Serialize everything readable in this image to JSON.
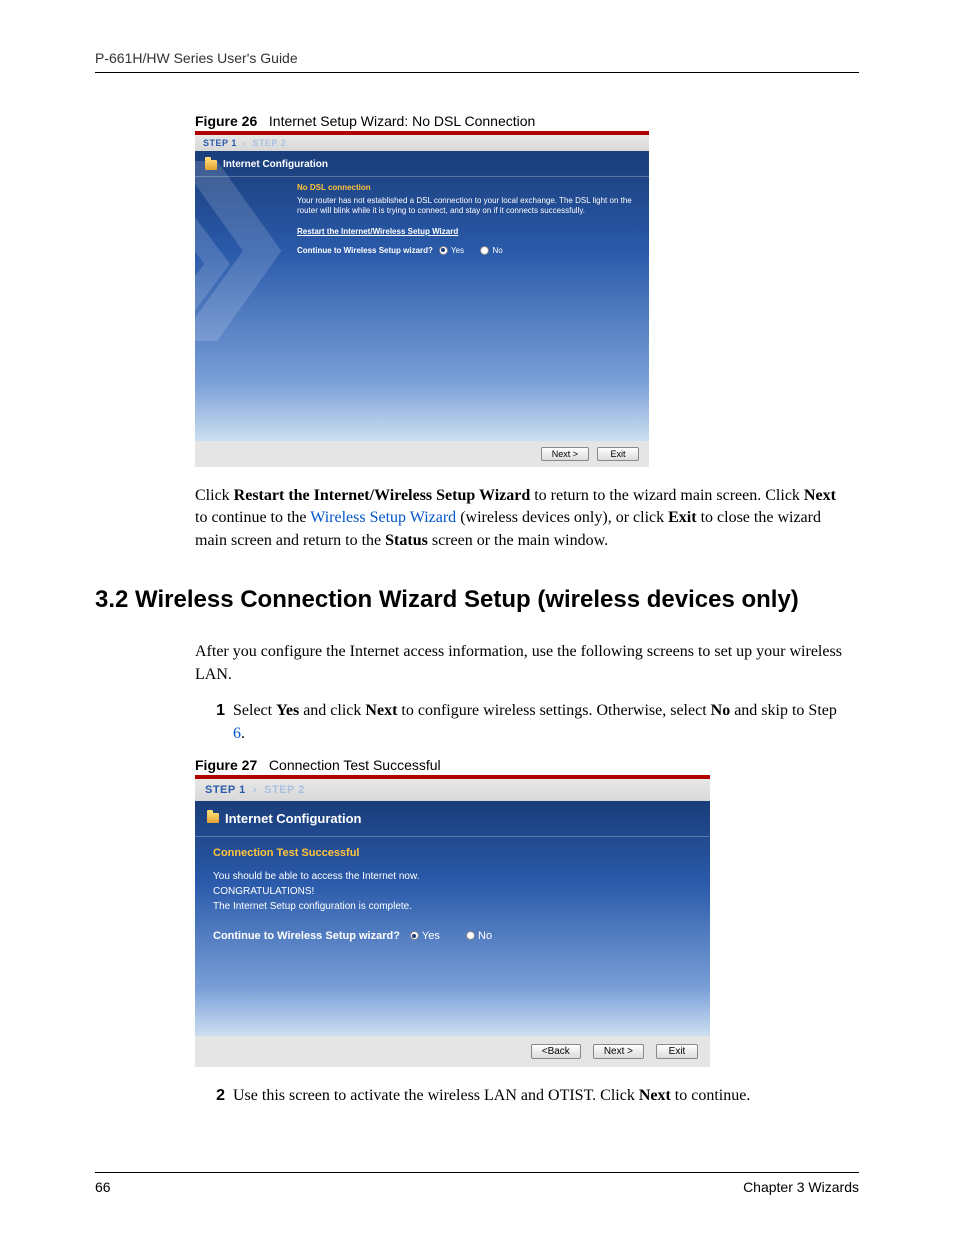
{
  "header": {
    "guide_title": "P-661H/HW Series User's Guide"
  },
  "fig26": {
    "label": "Figure 26",
    "title": "Internet Setup Wizard: No DSL Connection",
    "steps": {
      "s1": "STEP 1",
      "arrow": "›",
      "s2": "STEP 2"
    },
    "panel_title": "Internet Configuration",
    "status_title": "No DSL connection",
    "status_desc": "Your router has not established a DSL connection to your local exchange. The DSL light on the router will blink while it is trying to connect, and stay on if it connects successfully.",
    "restart_link": "Restart the Internet/Wireless Setup Wizard",
    "continue_label": "Continue to Wireless Setup wizard?",
    "yes": "Yes",
    "no": "No",
    "btn_next": "Next >",
    "btn_exit": "Exit"
  },
  "para1": {
    "pre": "Click ",
    "b1": "Restart the Internet/Wireless Setup Wizard",
    "mid1": " to return to the wizard main screen. Click ",
    "b2": "Next",
    "mid2": " to continue to the ",
    "link": "Wireless Setup Wizard",
    "mid3": " (wireless devices only), or click ",
    "b3": "Exit",
    "mid4": " to close the wizard main screen and return to the ",
    "b4": "Status",
    "end": " screen or the main window."
  },
  "section": {
    "heading": "3.2  Wireless Connection Wizard Setup (wireless devices only)"
  },
  "para2": "After you configure the Internet access information, use the following screens to set up your wireless LAN.",
  "step1": {
    "num": "1",
    "pre": "Select ",
    "b1": "Yes",
    "mid1": " and click ",
    "b2": "Next",
    "mid2": " to configure wireless settings. Otherwise, select ",
    "b3": "No",
    "mid3": " and skip to Step ",
    "link": "6",
    "end": "."
  },
  "fig27": {
    "label": "Figure 27",
    "title": "Connection Test Successful",
    "steps": {
      "s1": "STEP 1",
      "arrow": "›",
      "s2": "STEP 2"
    },
    "panel_title": "Internet Configuration",
    "status_title": "Connection Test Successful",
    "line1": "You should be able to access the Internet now.",
    "line2": "CONGRATULATIONS!",
    "line3": "The Internet Setup configuration is complete.",
    "continue_label": "Continue to Wireless Setup wizard?",
    "yes": "Yes",
    "no": "No",
    "btn_back": "<Back",
    "btn_next": "Next >",
    "btn_exit": "Exit"
  },
  "step2": {
    "num": "2",
    "pre": "Use this screen to activate the wireless LAN and OTIST. Click ",
    "b1": "Next",
    "end": " to continue."
  },
  "footer": {
    "page": "66",
    "chapter": "Chapter 3 Wizards"
  }
}
